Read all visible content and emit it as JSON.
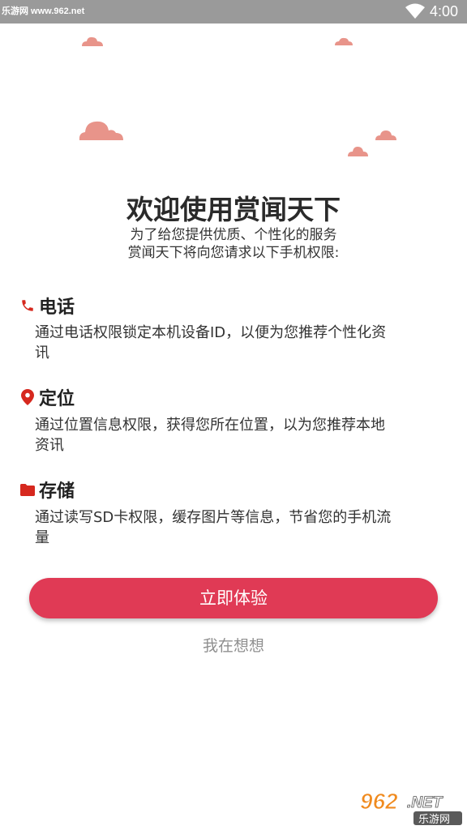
{
  "status_bar": {
    "watermark": "乐游网 www.962.net",
    "time": "4:00",
    "icons": [
      "wifi-icon"
    ]
  },
  "welcome": {
    "title": "欢迎使用赏闻天下",
    "subtitle_line1": "为了给您提供优质、个性化的服务",
    "subtitle_line2": "赏闻天下将向您请求以下手机权限:"
  },
  "permissions": [
    {
      "icon": "phone-icon",
      "label": "电话",
      "desc_line1": "通过电话权限锁定本机设备ID，以便为您推荐个性化资",
      "desc_line2": "讯"
    },
    {
      "icon": "location-pin-icon",
      "label": "定位",
      "desc_line1": "通过位置信息权限，获得您所在位置，以为您推荐本地",
      "desc_line2": "资讯"
    },
    {
      "icon": "folder-icon",
      "label": "存储",
      "desc_line1": "通过读写SD卡权限，缓存图片等信息，节省您的手机流",
      "desc_line2": "量"
    }
  ],
  "actions": {
    "primary_label": "立即体验",
    "secondary_label": "我在想想"
  },
  "colors": {
    "accent": "#e03a55",
    "icon_red": "#d6281e",
    "cloud": "#e8948a",
    "status_bar": "#9a9a9a"
  },
  "watermark_corner": {
    "big": "962.NET",
    "small": "乐游网"
  }
}
